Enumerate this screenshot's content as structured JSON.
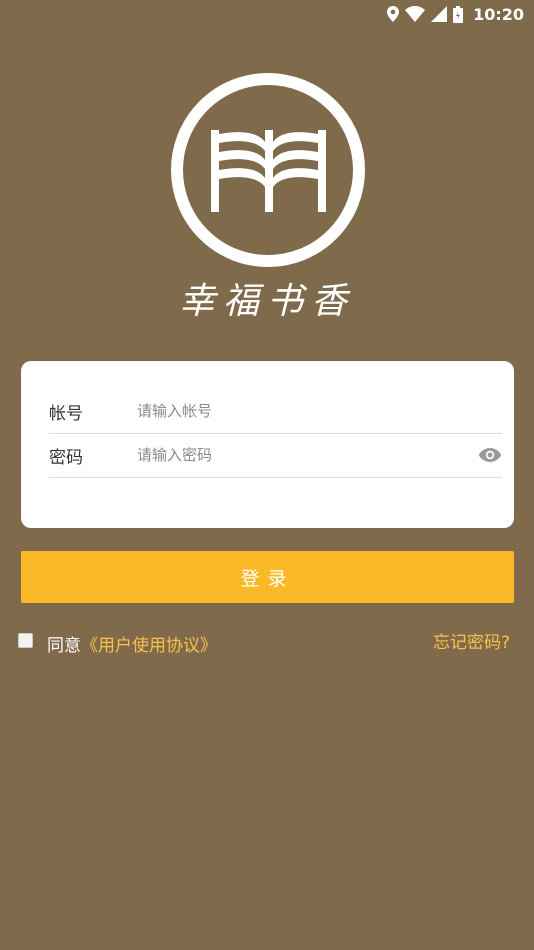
{
  "status_bar": {
    "time": "10:20",
    "icons": [
      "location-icon",
      "wifi-icon",
      "signal-icon",
      "battery-icon"
    ]
  },
  "brand": {
    "logo_icon": "bookshelf-logo-icon",
    "name": "幸福书香"
  },
  "login_form": {
    "account_label": "帐号",
    "account_placeholder": "请输入帐号",
    "password_label": "密码",
    "password_placeholder": "请输入密码",
    "toggle_icon": "eye-icon"
  },
  "login_button": {
    "label": "登录"
  },
  "agreement": {
    "prefix": "同意",
    "link": "《用户使用协议》",
    "checked": false
  },
  "forgot_password": {
    "label": "忘记密码?"
  },
  "colors": {
    "background": "#806a4c",
    "button": "#fbb827",
    "link": "#fbc24a",
    "card": "#ffffff"
  }
}
